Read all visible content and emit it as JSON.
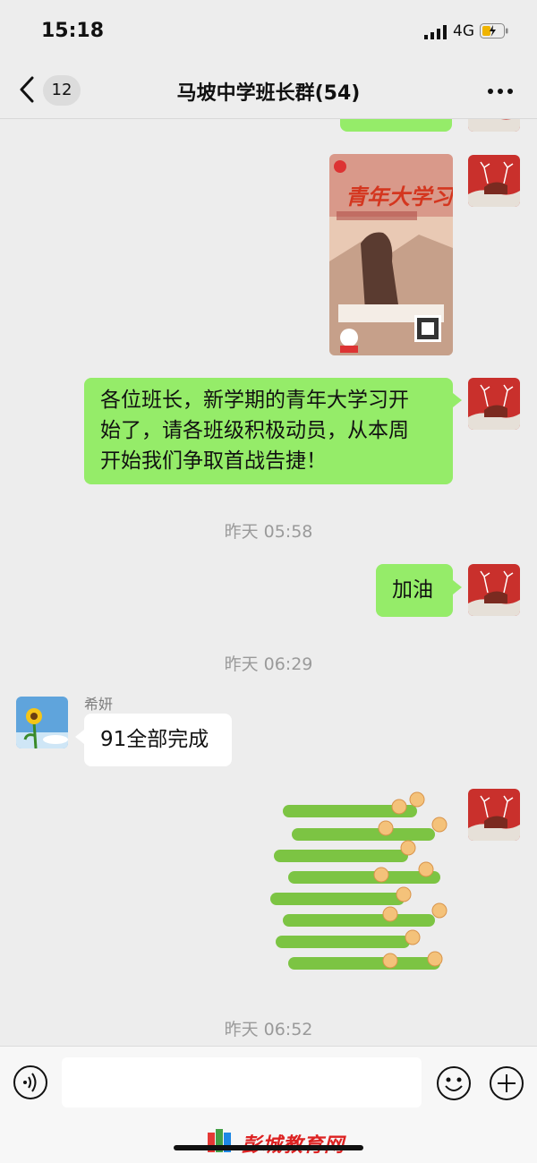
{
  "status_bar": {
    "time": "15:18",
    "network": "4G"
  },
  "nav": {
    "unread_count": "12",
    "title": "马坡中学班长群(54)"
  },
  "messages": {
    "m1": {
      "poster_title": "青年大学习"
    },
    "m2": {
      "text_line1": "各位班长，新学期的青年大学习开",
      "text_line2": "始了，请各班级积极动员，从本周",
      "text_line3": "开始我们争取首战告捷！"
    },
    "ts1": "昨天 05:58",
    "m3": {
      "text": "加油"
    },
    "ts2": "昨天 06:29",
    "m4": {
      "sender": "希妍",
      "text": "91全部完成"
    },
    "ts3": "昨天 06:52"
  },
  "input": {
    "placeholder": ""
  },
  "watermark": {
    "text": "彭城教育网"
  },
  "colors": {
    "bubble_green": "#95ec69",
    "background": "#ededed",
    "watermark_red": "#dd2222"
  }
}
